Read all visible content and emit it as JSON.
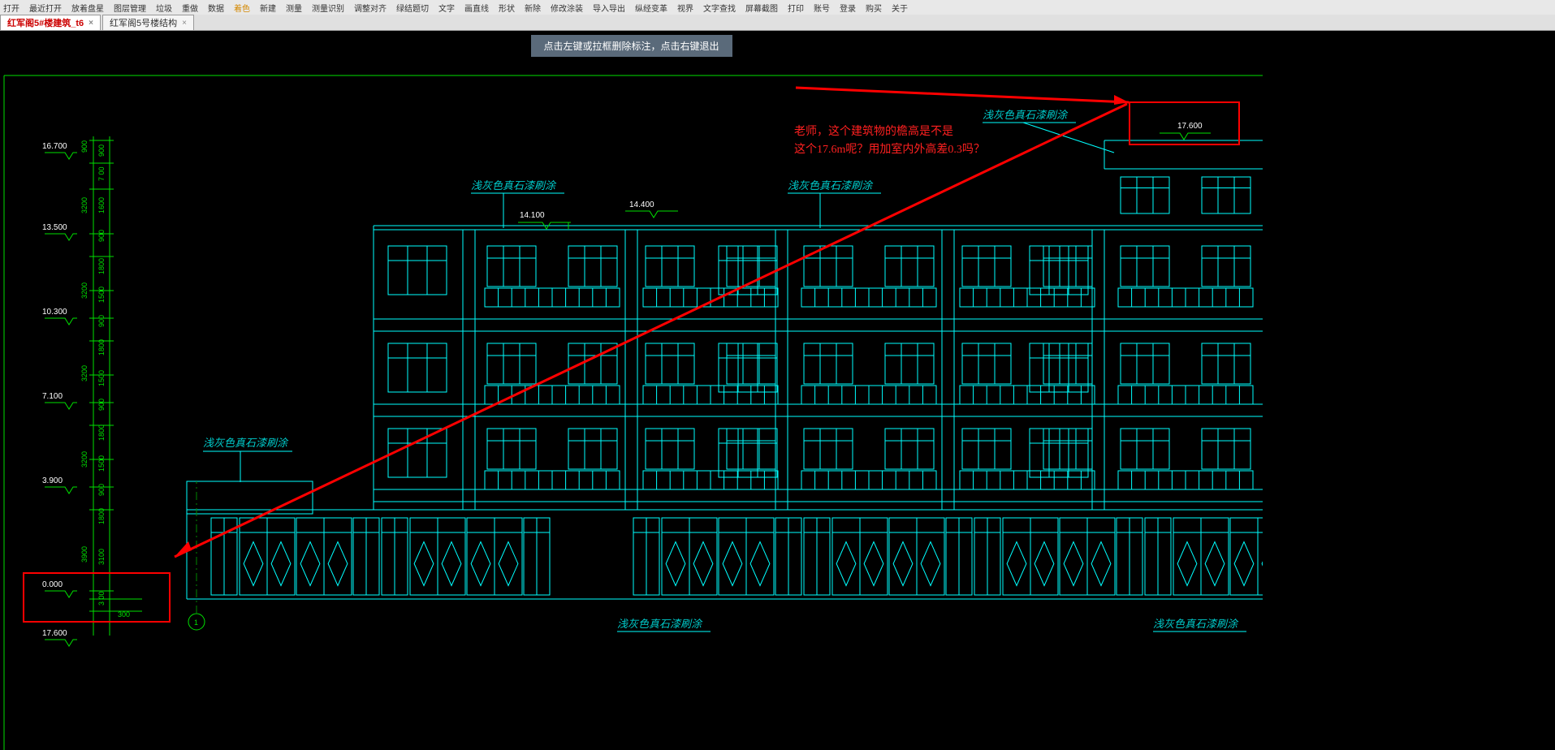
{
  "toolbar": {
    "items": [
      "打开",
      "最近打开",
      "放着盘星",
      "图层管理",
      "垃圾",
      "重做",
      "数据",
      "着色",
      "新建",
      "测量",
      "测量识别",
      "调整对齐",
      "绿结题切",
      "文字",
      "画直线",
      "形状",
      "新除",
      "修改涂装",
      "导入导出",
      "纵经变革",
      "视界",
      "文字查找",
      "屏幕截图",
      "打印",
      "账号",
      "登录",
      "购买",
      "关于"
    ]
  },
  "tabs": {
    "t1": "红军阁5#楼建筑_t6",
    "t2": "红军阁5号楼结构"
  },
  "hint": "点击左键或拉框删除标注，点击右键退出",
  "elevations": {
    "e1": "16.700",
    "e2": "13.500",
    "e3": "10.300",
    "e4": "7.100",
    "e5": "3.900",
    "e6": "0.000",
    "e7": "17.600",
    "e8": "14.100",
    "e9": "14.400",
    "e10": "17.600"
  },
  "dims": {
    "d1": "900",
    "d2": "900",
    "d3": "7 00",
    "d4": "3200",
    "d5": "1600",
    "d6": "900",
    "d7": "1800",
    "d8": "3200",
    "d9": "1500",
    "d10": "900",
    "d11": "1800",
    "d12": "3200",
    "d13": "1500",
    "d14": "900",
    "d15": "1800",
    "d16": "3200",
    "d17": "1500",
    "d18": "900",
    "d19": "1800",
    "d20": "3900",
    "d21": "3 00",
    "d22": "300",
    "d23": "3100"
  },
  "labels": {
    "paint": "浅灰色真石漆刷涂",
    "axis1": "1"
  },
  "annotation": {
    "line1": "老师，这个建筑物的檐高是不是",
    "line2": "这个17.6m呢？用加室内外高差0.3吗？"
  }
}
